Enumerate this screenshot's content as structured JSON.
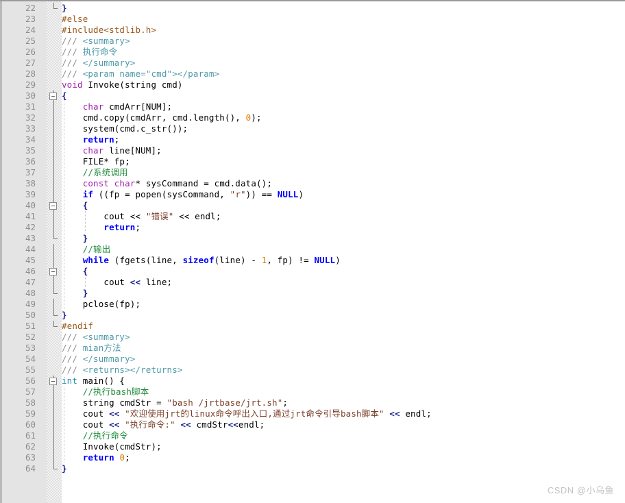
{
  "editor": {
    "language": "cpp",
    "first_line": 22,
    "last_line": 64,
    "colors": {
      "background": "#ffffff",
      "gutter_background": "#e4e4e4",
      "line_number": "#8e8e8e",
      "keyword": "#0000ff",
      "type": "#2b91af",
      "keyword_purple": "#a020b0",
      "preprocessor": "#9a5a1e",
      "string": "#7b3f28",
      "comment": "#1f8a3b",
      "doc_comment": "#8e8e8e",
      "xml_tag": "#4f9aa8",
      "number": "#e07b00",
      "text": "#000000"
    }
  },
  "watermark": {
    "text": "CSDN @小乌鱼"
  },
  "lines": [
    {
      "n": "22",
      "fold": "tick-up",
      "indent": 0,
      "tokens": [
        {
          "t": "}",
          "c": "brace"
        }
      ]
    },
    {
      "n": "23",
      "fold": "none",
      "indent": 0,
      "tokens": [
        {
          "t": "#else",
          "c": "pp"
        }
      ]
    },
    {
      "n": "24",
      "fold": "none",
      "indent": 0,
      "tokens": [
        {
          "t": "#include<stdlib.h>",
          "c": "pp"
        }
      ]
    },
    {
      "n": "25",
      "fold": "none",
      "indent": 0,
      "tokens": [
        {
          "t": "/// ",
          "c": "doc"
        },
        {
          "t": "<summary>",
          "c": "xml"
        }
      ]
    },
    {
      "n": "26",
      "fold": "none",
      "indent": 0,
      "tokens": [
        {
          "t": "/// ",
          "c": "doc"
        },
        {
          "t": "执行命令",
          "c": "xml"
        }
      ]
    },
    {
      "n": "27",
      "fold": "none",
      "indent": 0,
      "tokens": [
        {
          "t": "/// ",
          "c": "doc"
        },
        {
          "t": "</summary>",
          "c": "xml"
        }
      ]
    },
    {
      "n": "28",
      "fold": "none",
      "indent": 0,
      "tokens": [
        {
          "t": "/// ",
          "c": "doc"
        },
        {
          "t": "<param name=\"cmd\"></param>",
          "c": "xml"
        }
      ]
    },
    {
      "n": "29",
      "fold": "none",
      "indent": 0,
      "tokens": [
        {
          "t": "void",
          "c": "kw-pur"
        },
        {
          "t": " Invoke(string cmd)",
          "c": "plain"
        }
      ]
    },
    {
      "n": "30",
      "fold": "box",
      "indent": 0,
      "tokens": [
        {
          "t": "{",
          "c": "brace"
        }
      ]
    },
    {
      "n": "31",
      "fold": "line",
      "indent": 1,
      "tokens": [
        {
          "t": "    ",
          "c": "plain"
        },
        {
          "t": "char",
          "c": "kw-pur"
        },
        {
          "t": " cmdArr[NUM];",
          "c": "plain"
        }
      ]
    },
    {
      "n": "32",
      "fold": "line",
      "indent": 1,
      "tokens": [
        {
          "t": "    cmd.copy(cmdArr, cmd.length(), ",
          "c": "plain"
        },
        {
          "t": "0",
          "c": "num"
        },
        {
          "t": ");",
          "c": "plain"
        }
      ]
    },
    {
      "n": "33",
      "fold": "line",
      "indent": 1,
      "tokens": [
        {
          "t": "    system(cmd.c_str());",
          "c": "plain"
        }
      ]
    },
    {
      "n": "34",
      "fold": "line",
      "indent": 1,
      "tokens": [
        {
          "t": "    ",
          "c": "plain"
        },
        {
          "t": "return",
          "c": "kw"
        },
        {
          "t": ";",
          "c": "plain"
        }
      ]
    },
    {
      "n": "35",
      "fold": "line",
      "indent": 1,
      "tokens": [
        {
          "t": "    ",
          "c": "plain"
        },
        {
          "t": "char",
          "c": "kw-pur"
        },
        {
          "t": " line[NUM];",
          "c": "plain"
        }
      ]
    },
    {
      "n": "36",
      "fold": "line",
      "indent": 1,
      "tokens": [
        {
          "t": "    FILE* fp;",
          "c": "plain"
        }
      ]
    },
    {
      "n": "37",
      "fold": "line",
      "indent": 1,
      "tokens": [
        {
          "t": "    ",
          "c": "plain"
        },
        {
          "t": "//系统调用",
          "c": "cmt"
        }
      ]
    },
    {
      "n": "38",
      "fold": "line",
      "indent": 1,
      "tokens": [
        {
          "t": "    ",
          "c": "plain"
        },
        {
          "t": "const char",
          "c": "kw-pur"
        },
        {
          "t": "* sysCommand = cmd.data();",
          "c": "plain"
        }
      ]
    },
    {
      "n": "39",
      "fold": "line",
      "indent": 1,
      "tokens": [
        {
          "t": "    ",
          "c": "plain"
        },
        {
          "t": "if",
          "c": "kw"
        },
        {
          "t": " ((fp = popen(sysCommand, ",
          "c": "plain"
        },
        {
          "t": "\"r\"",
          "c": "str"
        },
        {
          "t": ")) == ",
          "c": "plain"
        },
        {
          "t": "NULL",
          "c": "kw"
        },
        {
          "t": ")",
          "c": "plain"
        }
      ]
    },
    {
      "n": "40",
      "fold": "box",
      "indent": 1,
      "tokens": [
        {
          "t": "    ",
          "c": "plain"
        },
        {
          "t": "{",
          "c": "brace"
        }
      ]
    },
    {
      "n": "41",
      "fold": "line",
      "indent": 2,
      "tokens": [
        {
          "t": "        cout << ",
          "c": "plain"
        },
        {
          "t": "\"错误\"",
          "c": "str"
        },
        {
          "t": " << endl;",
          "c": "plain"
        }
      ]
    },
    {
      "n": "42",
      "fold": "line",
      "indent": 2,
      "tokens": [
        {
          "t": "        ",
          "c": "plain"
        },
        {
          "t": "return",
          "c": "kw"
        },
        {
          "t": ";",
          "c": "plain"
        }
      ]
    },
    {
      "n": "43",
      "fold": "tick-up",
      "indent": 1,
      "tokens": [
        {
          "t": "    ",
          "c": "plain"
        },
        {
          "t": "}",
          "c": "brace"
        }
      ]
    },
    {
      "n": "44",
      "fold": "line",
      "indent": 1,
      "tokens": [
        {
          "t": "    ",
          "c": "plain"
        },
        {
          "t": "//输出",
          "c": "cmt"
        }
      ]
    },
    {
      "n": "45",
      "fold": "line",
      "indent": 1,
      "tokens": [
        {
          "t": "    ",
          "c": "plain"
        },
        {
          "t": "while",
          "c": "kw"
        },
        {
          "t": " (fgets(line, ",
          "c": "plain"
        },
        {
          "t": "sizeof",
          "c": "kw"
        },
        {
          "t": "(line) - ",
          "c": "plain"
        },
        {
          "t": "1",
          "c": "num"
        },
        {
          "t": ", fp) != ",
          "c": "plain"
        },
        {
          "t": "NULL",
          "c": "kw"
        },
        {
          "t": ")",
          "c": "plain"
        }
      ]
    },
    {
      "n": "46",
      "fold": "box",
      "indent": 1,
      "tokens": [
        {
          "t": "    ",
          "c": "plain"
        },
        {
          "t": "{",
          "c": "brace"
        }
      ]
    },
    {
      "n": "47",
      "fold": "line",
      "indent": 2,
      "tokens": [
        {
          "t": "        cout ",
          "c": "plain"
        },
        {
          "t": "<<",
          "c": "brace"
        },
        {
          "t": " line;",
          "c": "plain"
        }
      ]
    },
    {
      "n": "48",
      "fold": "tick-up",
      "indent": 1,
      "tokens": [
        {
          "t": "    ",
          "c": "plain"
        },
        {
          "t": "}",
          "c": "brace"
        }
      ]
    },
    {
      "n": "49",
      "fold": "line",
      "indent": 1,
      "tokens": [
        {
          "t": "    pclose(fp);",
          "c": "plain"
        }
      ]
    },
    {
      "n": "50",
      "fold": "tick-up",
      "indent": 0,
      "tokens": [
        {
          "t": "}",
          "c": "brace"
        }
      ]
    },
    {
      "n": "51",
      "fold": "tick-end",
      "indent": 0,
      "tokens": [
        {
          "t": "#endif",
          "c": "pp"
        }
      ]
    },
    {
      "n": "52",
      "fold": "none",
      "indent": 0,
      "tokens": [
        {
          "t": "/// ",
          "c": "doc"
        },
        {
          "t": "<summary>",
          "c": "xml"
        }
      ]
    },
    {
      "n": "53",
      "fold": "none",
      "indent": 0,
      "tokens": [
        {
          "t": "/// ",
          "c": "doc"
        },
        {
          "t": "mian方法",
          "c": "xml"
        }
      ]
    },
    {
      "n": "54",
      "fold": "none",
      "indent": 0,
      "tokens": [
        {
          "t": "/// ",
          "c": "doc"
        },
        {
          "t": "</summary>",
          "c": "xml"
        }
      ]
    },
    {
      "n": "55",
      "fold": "none",
      "indent": 0,
      "tokens": [
        {
          "t": "/// ",
          "c": "doc"
        },
        {
          "t": "<returns></returns>",
          "c": "xml"
        }
      ]
    },
    {
      "n": "56",
      "fold": "box",
      "indent": 0,
      "tokens": [
        {
          "t": "int",
          "c": "type"
        },
        {
          "t": " main() {",
          "c": "plain"
        }
      ]
    },
    {
      "n": "57",
      "fold": "line",
      "indent": 1,
      "tokens": [
        {
          "t": "    ",
          "c": "plain"
        },
        {
          "t": "//执行bash脚本",
          "c": "cmt"
        }
      ]
    },
    {
      "n": "58",
      "fold": "line",
      "indent": 1,
      "tokens": [
        {
          "t": "    string cmdStr = ",
          "c": "plain"
        },
        {
          "t": "\"bash /jrtbase/jrt.sh\"",
          "c": "str"
        },
        {
          "t": ";",
          "c": "plain"
        }
      ]
    },
    {
      "n": "59",
      "fold": "line",
      "indent": 1,
      "tokens": [
        {
          "t": "    cout ",
          "c": "plain"
        },
        {
          "t": "<<",
          "c": "brace"
        },
        {
          "t": " ",
          "c": "plain"
        },
        {
          "t": "\"欢迎使用jrt的linux命令呼出入口,通过jrt命令引导bash脚本\"",
          "c": "str"
        },
        {
          "t": " ",
          "c": "plain"
        },
        {
          "t": "<<",
          "c": "brace"
        },
        {
          "t": " endl;",
          "c": "plain"
        }
      ]
    },
    {
      "n": "60",
      "fold": "line",
      "indent": 1,
      "tokens": [
        {
          "t": "    cout ",
          "c": "plain"
        },
        {
          "t": "<<",
          "c": "brace"
        },
        {
          "t": " ",
          "c": "plain"
        },
        {
          "t": "\"执行命令:\"",
          "c": "str"
        },
        {
          "t": " ",
          "c": "plain"
        },
        {
          "t": "<<",
          "c": "brace"
        },
        {
          "t": " cmdStr",
          "c": "plain"
        },
        {
          "t": "<<",
          "c": "brace"
        },
        {
          "t": "endl;",
          "c": "plain"
        }
      ]
    },
    {
      "n": "61",
      "fold": "line",
      "indent": 1,
      "tokens": [
        {
          "t": "    ",
          "c": "plain"
        },
        {
          "t": "//执行命令",
          "c": "cmt"
        }
      ]
    },
    {
      "n": "62",
      "fold": "line",
      "indent": 1,
      "tokens": [
        {
          "t": "    Invoke(cmdStr);",
          "c": "plain"
        }
      ]
    },
    {
      "n": "63",
      "fold": "line",
      "indent": 1,
      "tokens": [
        {
          "t": "    ",
          "c": "plain"
        },
        {
          "t": "return",
          "c": "kw"
        },
        {
          "t": " ",
          "c": "plain"
        },
        {
          "t": "0",
          "c": "num"
        },
        {
          "t": ";",
          "c": "plain"
        }
      ]
    },
    {
      "n": "64",
      "fold": "tick-up",
      "indent": 0,
      "tokens": [
        {
          "t": "}",
          "c": "brace"
        }
      ]
    }
  ]
}
